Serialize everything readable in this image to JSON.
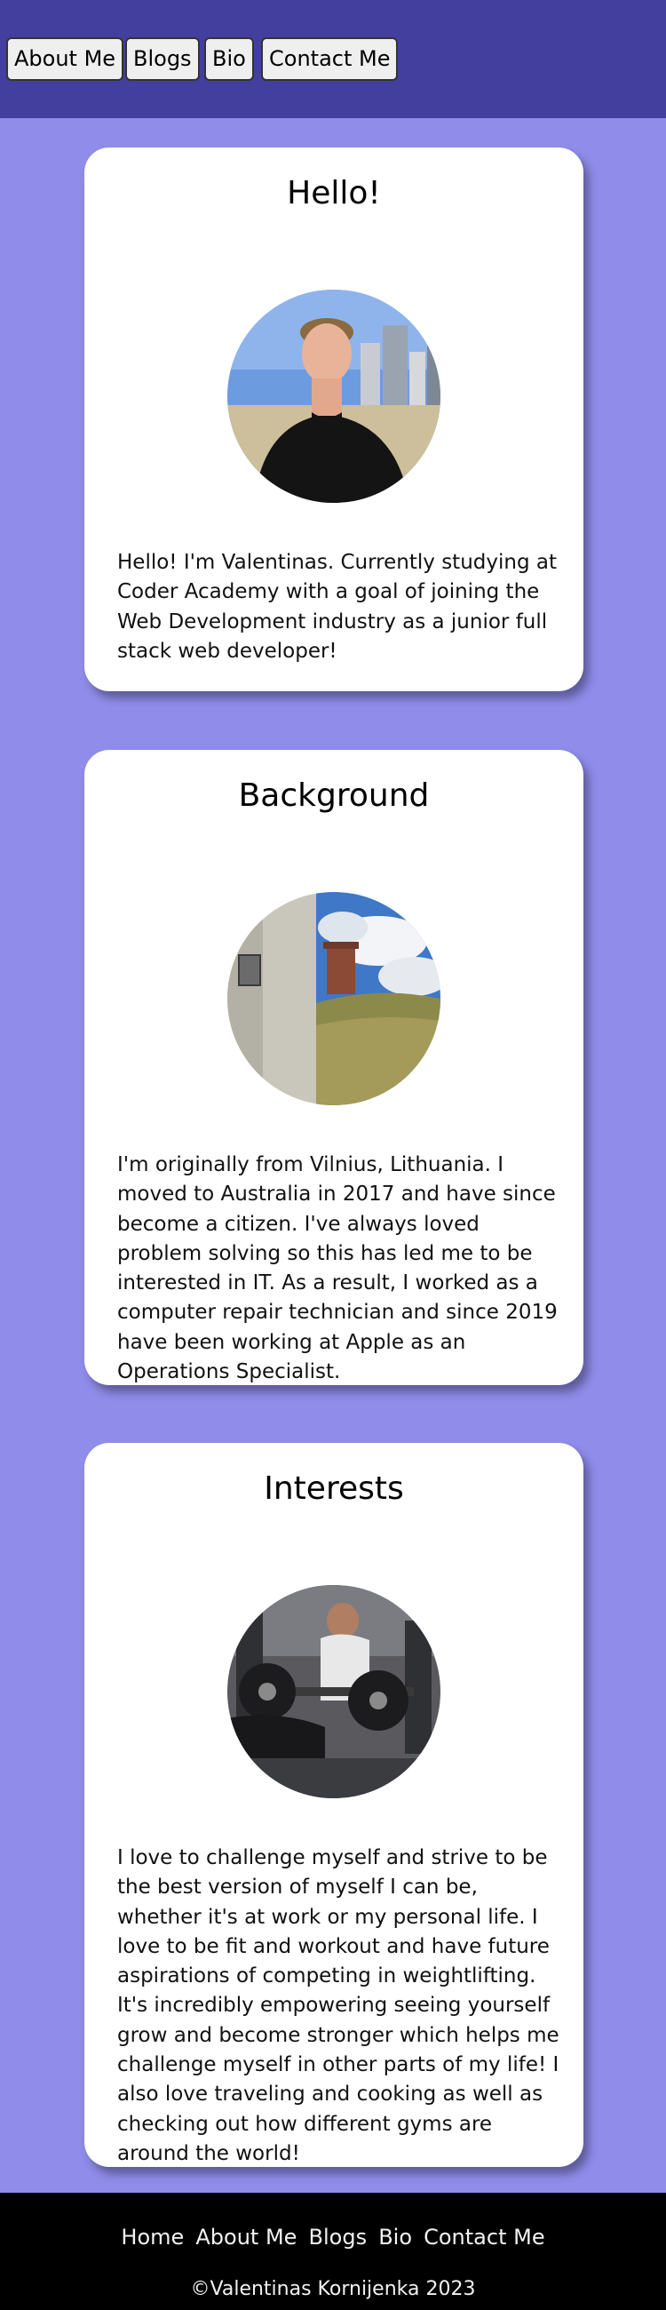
{
  "nav": {
    "about": "About Me",
    "blogs": "Blogs",
    "bio": "Bio",
    "contact": "Contact Me"
  },
  "cards": [
    {
      "title": "Hello!",
      "text": "Hello! I'm Valentinas. Currently studying at Coder Academy with a goal of joining the Web Development industry as a junior full stack web developer!"
    },
    {
      "title": "Background",
      "text": "I'm originally from Vilnius, Lithuania. I moved to Australia in 2017 and have since become a citizen. I've always loved problem solving so this has led me to be interested in IT. As a result, I worked as a computer repair technician and since 2019 have been working at Apple as an Operations Specialist."
    },
    {
      "title": "Interests",
      "text": "I love to challenge myself and strive to be the best version of myself I can be, whether it's at work or my personal life. I love to be fit and workout and have future aspirations of competing in weightlifting. It's incredibly empowering seeing yourself grow and become stronger which helps me challenge myself in other parts of my life! I also love traveling and cooking as well as checking out how different gyms are around the world!"
    }
  ],
  "footer": {
    "home": "Home",
    "about": "About Me",
    "blogs": "Blogs",
    "bio": "Bio",
    "contact": "Contact Me",
    "copyright": "©Valentinas Kornijenka 2023"
  }
}
